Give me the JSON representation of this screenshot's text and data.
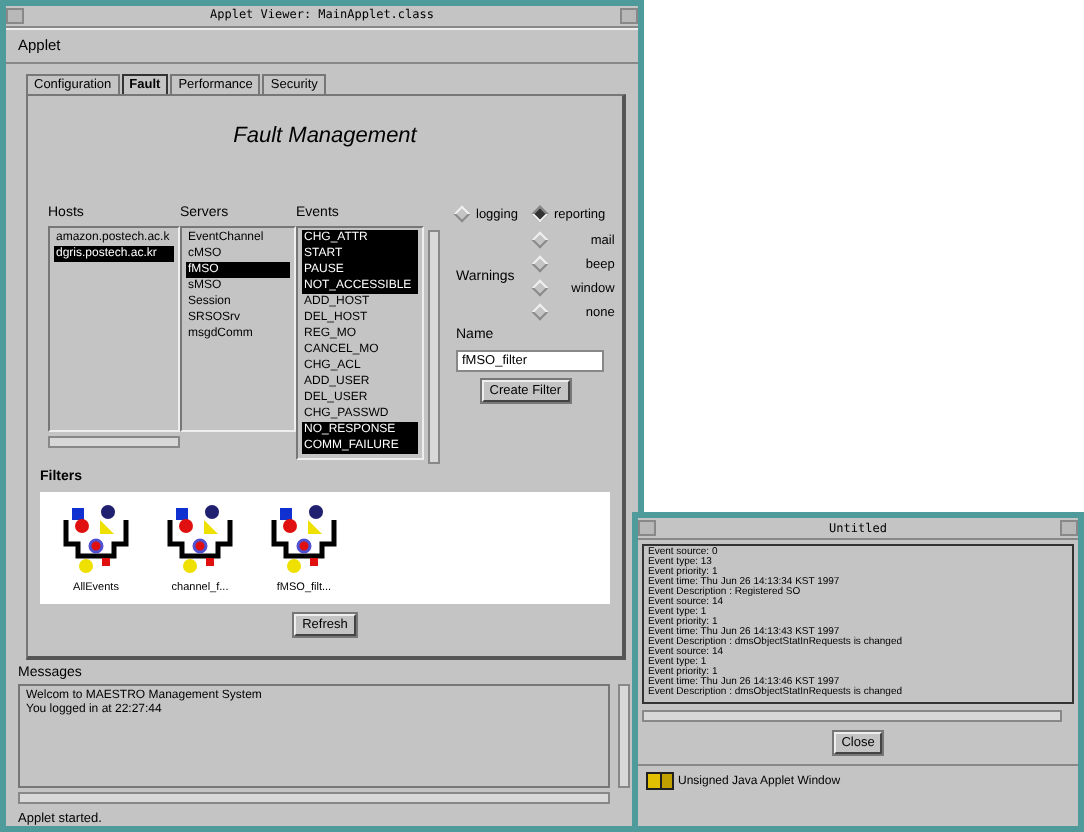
{
  "applet_window": {
    "title": "Applet Viewer: MainApplet.class",
    "menu": [
      "Applet"
    ],
    "tabs": [
      {
        "label": "Configuration",
        "selected": false
      },
      {
        "label": "Fault",
        "selected": true
      },
      {
        "label": "Performance",
        "selected": false
      },
      {
        "label": "Security",
        "selected": false
      }
    ],
    "heading": "Fault Management",
    "lists": [
      {
        "label": "Hosts",
        "items": [
          {
            "text": "amazon.postech.ac.k",
            "selected": false
          },
          {
            "text": "dgris.postech.ac.kr",
            "selected": true
          }
        ]
      },
      {
        "label": "Servers",
        "items": [
          {
            "text": "EventChannel",
            "selected": false
          },
          {
            "text": "cMSO",
            "selected": false
          },
          {
            "text": "fMSO",
            "selected": true
          },
          {
            "text": "sMSO",
            "selected": false
          },
          {
            "text": "Session",
            "selected": false
          },
          {
            "text": "SRSOSrv",
            "selected": false
          },
          {
            "text": "msgdComm",
            "selected": false
          }
        ]
      },
      {
        "label": "Events",
        "items": [
          {
            "text": "CHG_ATTR",
            "selected": true
          },
          {
            "text": "START",
            "selected": true
          },
          {
            "text": "PAUSE",
            "selected": true
          },
          {
            "text": "NOT_ACCESSIBLE",
            "selected": true
          },
          {
            "text": "ADD_HOST",
            "selected": false
          },
          {
            "text": "DEL_HOST",
            "selected": false
          },
          {
            "text": "REG_MO",
            "selected": false
          },
          {
            "text": "CANCEL_MO",
            "selected": false
          },
          {
            "text": "CHG_ACL",
            "selected": false
          },
          {
            "text": "ADD_USER",
            "selected": false
          },
          {
            "text": "DEL_USER",
            "selected": false
          },
          {
            "text": "CHG_PASSWD",
            "selected": false
          },
          {
            "text": "NO_RESPONSE",
            "selected": true
          },
          {
            "text": "COMM_FAILURE",
            "selected": true
          }
        ]
      }
    ],
    "modes": [
      {
        "label": "logging",
        "selected": false
      },
      {
        "label": "reporting",
        "selected": true
      }
    ],
    "warnings": {
      "label": "Warnings",
      "options": [
        {
          "label": "mail",
          "selected": false
        },
        {
          "label": "beep",
          "selected": false
        },
        {
          "label": "window",
          "selected": false
        },
        {
          "label": "none",
          "selected": false
        }
      ]
    },
    "name": {
      "label": "Name",
      "value": "fMSO_filter"
    },
    "create_button": "Create Filter",
    "filters": {
      "label": "Filters",
      "items": [
        {
          "label": "AllEvents"
        },
        {
          "label": "channel_f..."
        },
        {
          "label": "fMSO_filt..."
        }
      ]
    },
    "refresh_button": "Refresh",
    "messages": {
      "label": "Messages",
      "lines": [
        "Welcom to MAESTRO Management System",
        "You logged in at 22:27:44"
      ]
    },
    "status": "Applet started."
  },
  "untitled_window": {
    "title": "Untitled",
    "lines": [
      "Event source: 0",
      "Event type: 13",
      "Event priority: 1",
      "Event time: Thu Jun 26 14:13:34 KST 1997",
      "Event Description : Registered SO",
      "Event source: 14",
      "Event type: 1",
      "Event priority: 1",
      "Event time: Thu Jun 26 14:13:43 KST 1997",
      "Event Description : dmsObjectStatInRequests is changed",
      "Event source: 14",
      "Event type: 1",
      "Event priority: 1",
      "Event time: Thu Jun 26 14:13:46 KST 1997",
      "Event Description : dmsObjectStatInRequests is changed"
    ],
    "close_button": "Close",
    "status": "Unsigned Java Applet Window"
  }
}
